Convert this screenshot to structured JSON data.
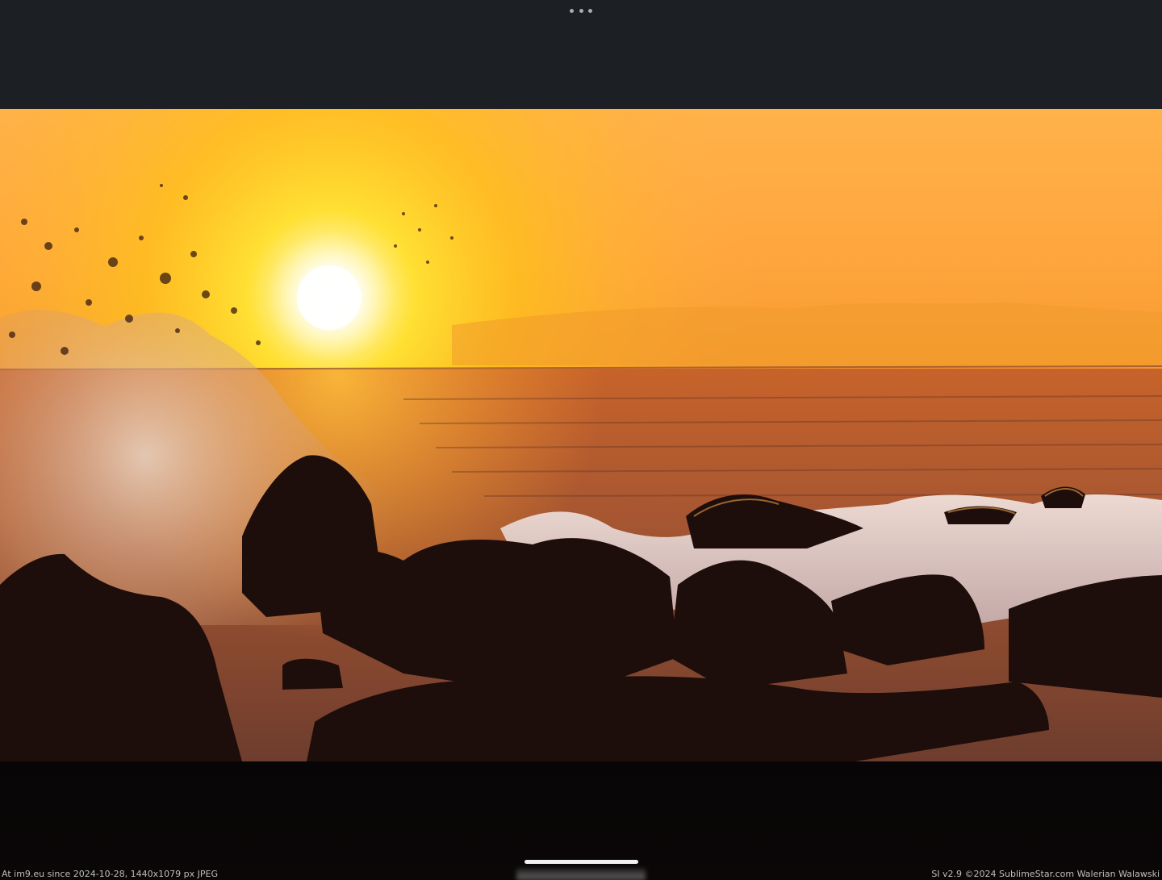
{
  "icons": {
    "more": "more-horizontal-icon"
  },
  "photo": {
    "subject": "sunset-ocean-waves-rocks"
  },
  "footer": {
    "left_text": "At im9.eu since 2024-10-28, 1440x1079 px JPEG",
    "right_text": "SI v2.9 ©2024 SublimeStar.com Walerian Walawski"
  },
  "colors": {
    "top_bar": "#1c1f23",
    "bottom_bar": "#070506",
    "sky_top": "#ffb347",
    "sun": "#fffde6",
    "sea": "#a0502a",
    "rocks": "#1a0c0a"
  }
}
